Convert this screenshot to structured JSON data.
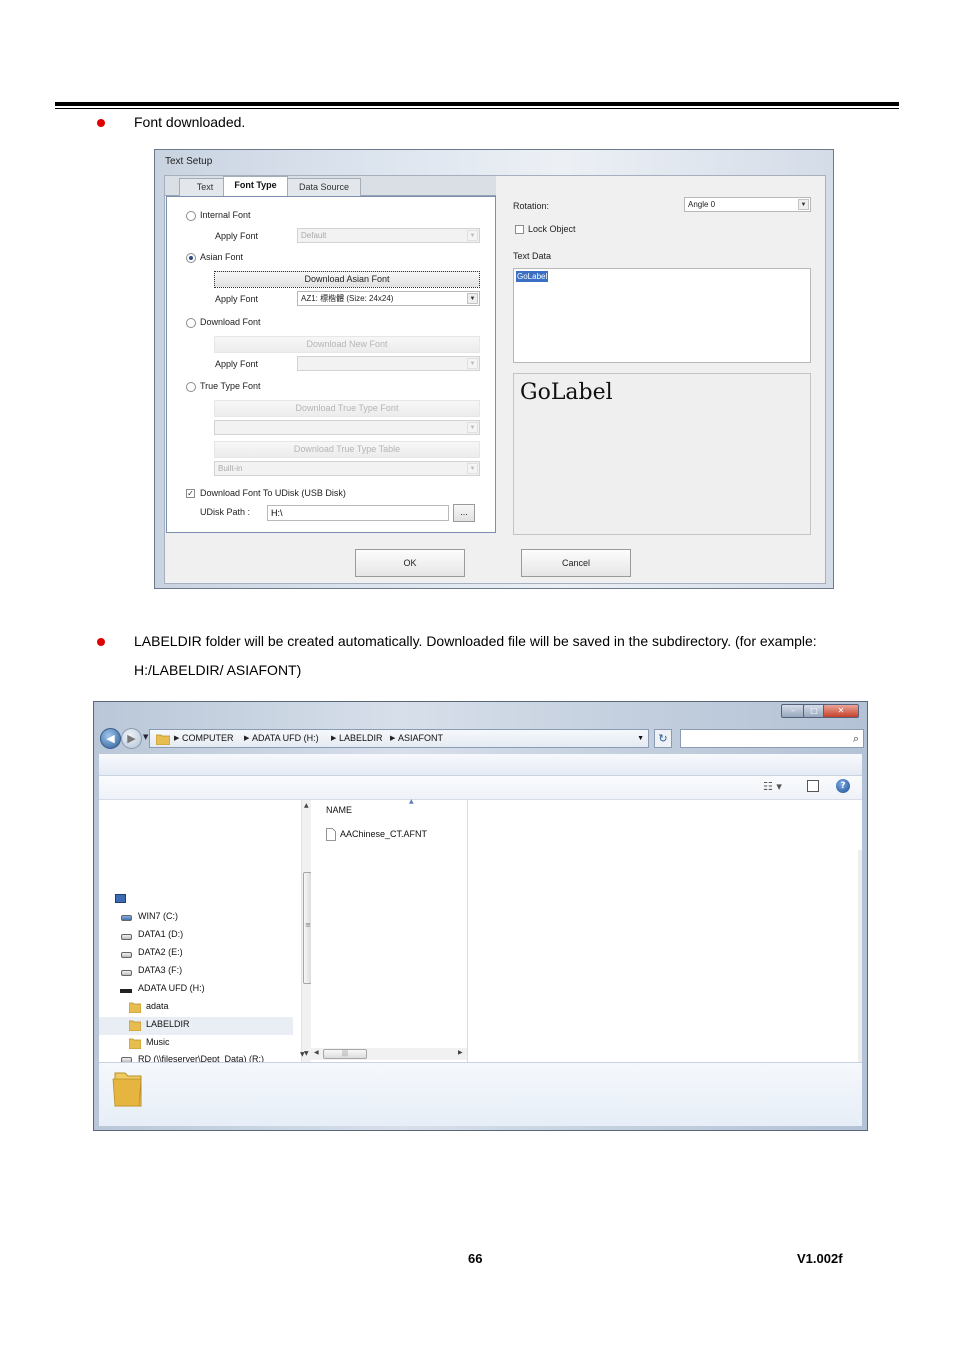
{
  "bullets": [
    {
      "text": "Font downloaded."
    },
    {
      "line1": "LABELDIR folder will be created automatically. Downloaded file will be saved in the subdirectory. (for example:",
      "line2": "H:/LABELDIR/ ASIAFONT)"
    }
  ],
  "dialog": {
    "title": "Text Setup",
    "tabs": [
      "Text",
      "Font Type",
      "Data Source"
    ],
    "internal_font_label": "Internal Font",
    "apply_font_label": "Apply Font",
    "internal_font_value": "Default",
    "asian_font_label": "Asian Font",
    "download_asian_font_button": "Download Asian Font",
    "asian_font_value": "AZ1: 標楷體  (Size: 24x24)",
    "download_font_label": "Download Font",
    "download_new_font_button": "Download New Font",
    "true_type_font_label": "True Type Font",
    "download_true_type_font_button": "Download True Type Font",
    "download_true_type_table_button": "Download True Type Table",
    "table_value": "Built-in",
    "udisk_checkbox_label": "Download Font To UDisk (USB Disk)",
    "udisk_path_label": "UDisk Path :",
    "udisk_path_value": "H:\\",
    "browse_button": "...",
    "rotation_label": "Rotation:",
    "rotation_value": "Angle 0",
    "lock_object_label": "Lock Object",
    "text_data_label": "Text Data",
    "text_data_value": "GoLabel",
    "preview_text": "GoLabel",
    "ok_button": "OK",
    "cancel_button": "Cancel",
    "selected_radio": "asian_font"
  },
  "explorer": {
    "breadcrumb": [
      "COMPUTER",
      "ADATA UFD (H:)",
      "LABELDIR",
      "ASIAFONT"
    ],
    "column_name": "NAME",
    "files": [
      "AAChinese_CT.AFNT"
    ],
    "tree": [
      "WIN7 (C:)",
      "DATA1 (D:)",
      "DATA2 (E:)",
      "DATA3 (F:)",
      "ADATA UFD (H:)",
      "adata",
      "LABELDIR",
      "Music",
      "RD (\\\\fileserver\\Dept_Data) (R:)"
    ],
    "selected_tree_item": "LABELDIR",
    "scroll_grip": "≡",
    "hscroll_grip": "|||"
  },
  "footer": {
    "page_number": "66",
    "version": "V1.002f"
  },
  "colors": {
    "bullet": "#e00000",
    "selection": "#3a6fc4"
  }
}
